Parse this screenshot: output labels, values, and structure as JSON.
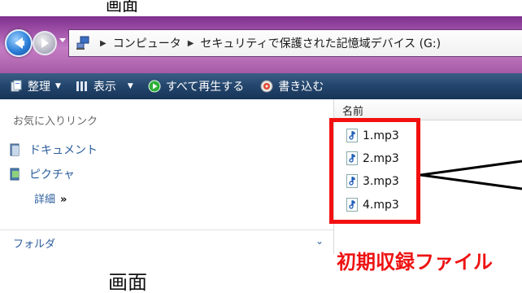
{
  "top_clip_text": "画面",
  "address": {
    "crumbs": [
      "コンピュータ",
      "セキュリティで保護された記憶域デバイス (G:)"
    ]
  },
  "toolbar": {
    "organize": "整理",
    "views": "表示",
    "play_all": "すべて再生する",
    "burn": "書き込む"
  },
  "sidebar": {
    "favorites_header": "お気に入りリンク",
    "links": [
      "ドキュメント",
      "ピクチャ"
    ],
    "details": "詳細",
    "details_chevron": "»",
    "folders_label": "フォルダ"
  },
  "file_list": {
    "column_name": "名前",
    "files": [
      "1.mp3",
      "2.mp3",
      "3.mp3",
      "4.mp3"
    ]
  },
  "annotation": {
    "label": "初期収録ファイル",
    "color": "#ee1212"
  },
  "bottom_caption": "画面"
}
